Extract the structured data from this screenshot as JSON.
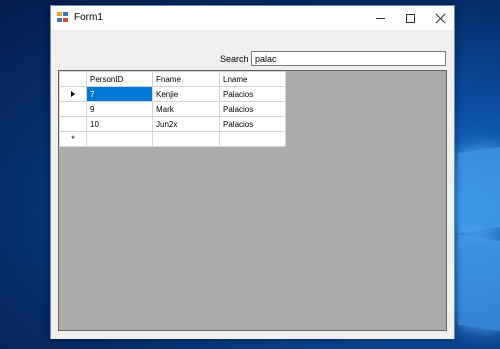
{
  "window": {
    "title": "Form1"
  },
  "search": {
    "label": "Search :",
    "value": "palac"
  },
  "grid": {
    "columns": [
      "PersonID",
      "Fname",
      "Lname"
    ],
    "rows": [
      {
        "PersonID": "7",
        "Fname": "Kenjie",
        "Lname": "Palacios",
        "current": true
      },
      {
        "PersonID": "9",
        "Fname": "Mark",
        "Lname": "Palacios",
        "current": false
      },
      {
        "PersonID": "10",
        "Fname": "Jun2x",
        "Lname": "Palacios",
        "current": false
      }
    ],
    "new_row_marker": "*",
    "selected_cell": "PersonID of row 1"
  },
  "colors": {
    "selection": "#0078d7",
    "grid_background": "#ababab",
    "window_background": "#f0f0f0"
  },
  "icons": {
    "app": "winforms-app-icon",
    "minimize": "minimize-icon",
    "maximize": "maximize-icon",
    "close": "close-icon",
    "current_row": "row-pointer-icon"
  }
}
